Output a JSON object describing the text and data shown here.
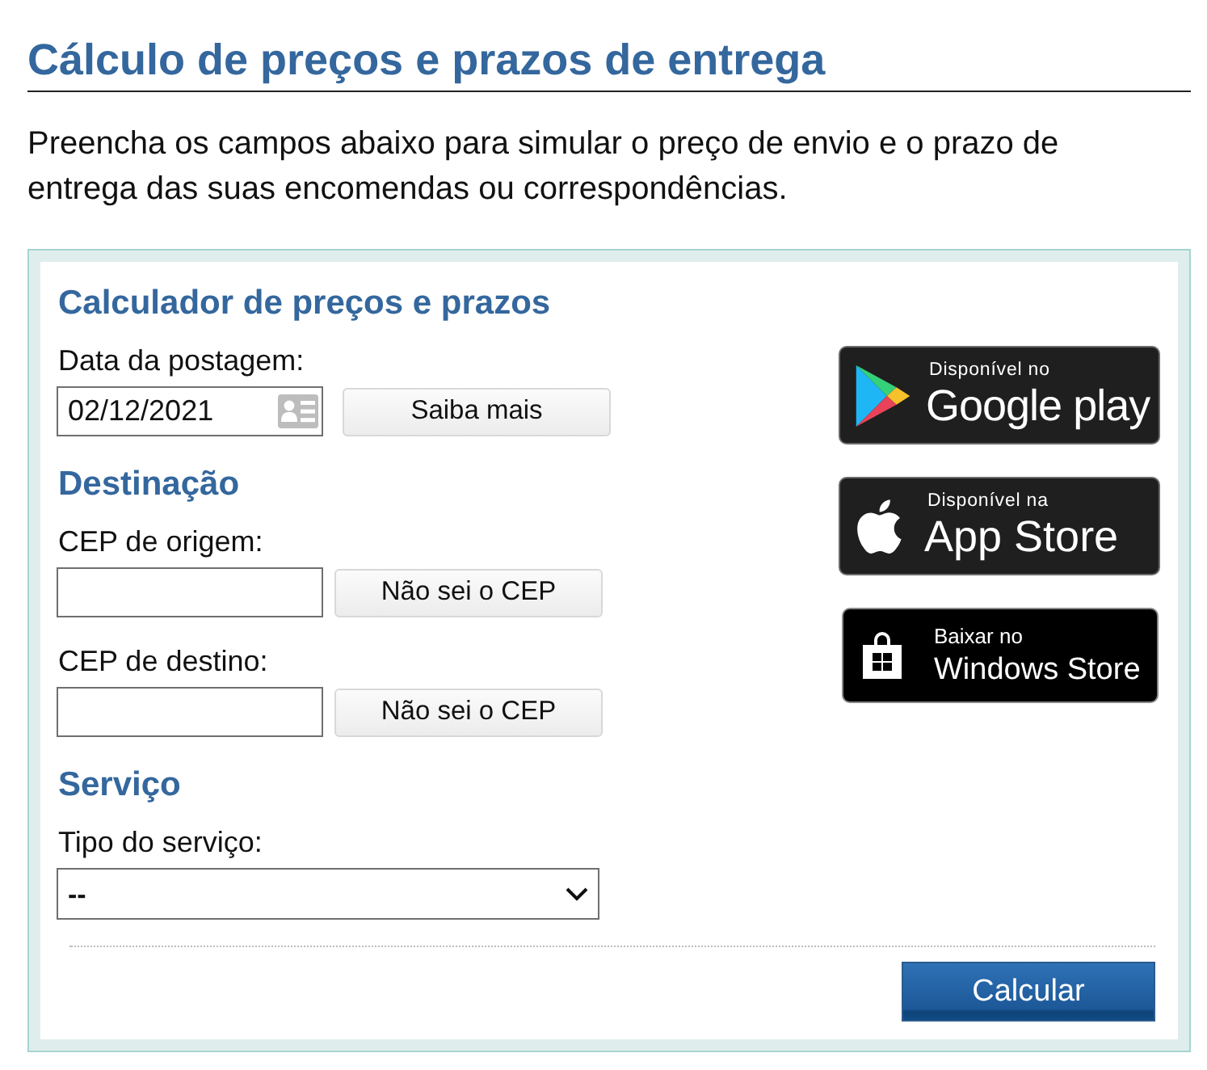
{
  "page": {
    "title": "Cálculo de preços e prazos de entrega",
    "intro": "Preencha os campos abaixo para simular o preço de envio e o prazo de entrega das suas encomendas ou correspondências."
  },
  "calculator": {
    "sections": [
      {
        "heading": "Calculador de preços e prazos",
        "fields": [
          {
            "kind": "date",
            "label": "Data da postagem:",
            "value": "02/12/2021",
            "button": "Saiba mais"
          }
        ]
      },
      {
        "heading": "Destinação",
        "fields": [
          {
            "kind": "text",
            "label": "CEP de origem:",
            "button": "Não sei o CEP"
          },
          {
            "kind": "text",
            "label": "CEP de destino:",
            "button": "Não sei o CEP"
          }
        ]
      },
      {
        "heading": "Serviço",
        "fields": [
          {
            "kind": "select",
            "label": "Tipo do serviço:",
            "value": "--"
          }
        ]
      }
    ],
    "store_badges": [
      {
        "kind": "google-play",
        "caption": "Disponível no",
        "name": "Google play"
      },
      {
        "kind": "app-store",
        "caption": "Disponível na",
        "name": "App Store"
      },
      {
        "kind": "windows-store",
        "caption": "Baixar no",
        "name": "Windows Store"
      }
    ],
    "submit": "Calcular"
  }
}
